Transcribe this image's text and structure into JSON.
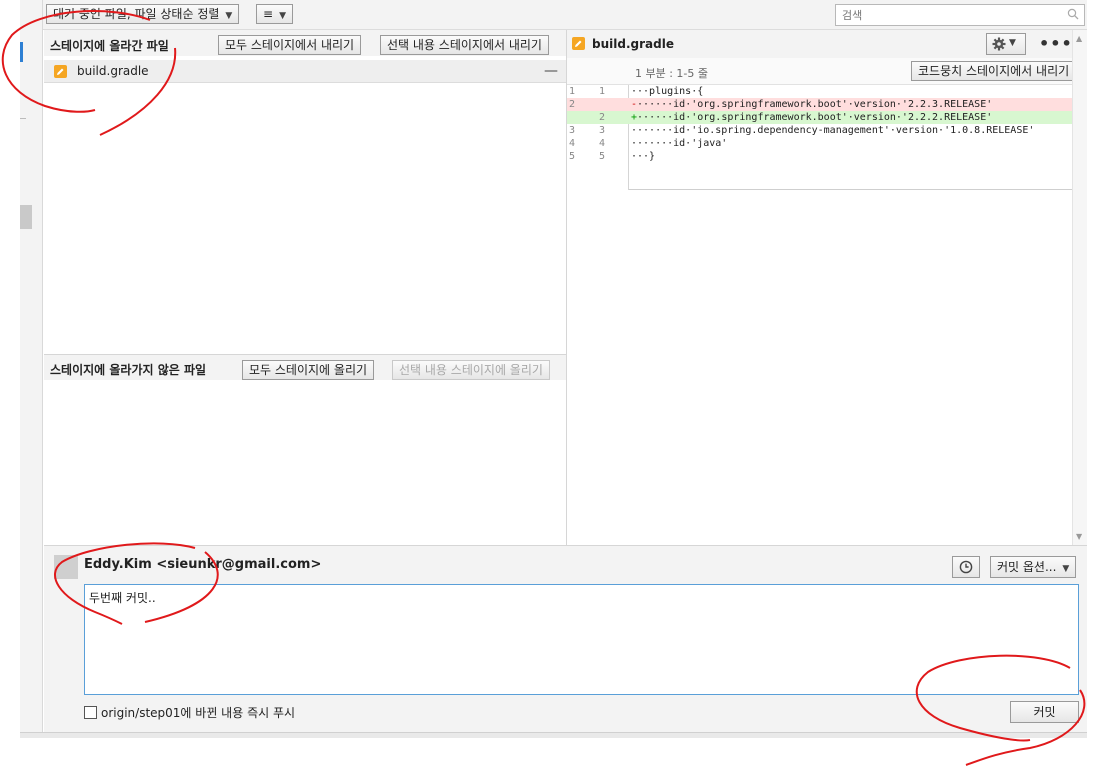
{
  "toolbar": {
    "filter_label": "대기 중인 파일, 파일 상태순 정렬",
    "view_label": "≡",
    "search_placeholder": "검색"
  },
  "staged": {
    "title": "스테이지에 올라간 파일",
    "unstage_all": "모두 스테이지에서 내리기",
    "unstage_selected": "선택 내용 스테이지에서 내리기",
    "files": [
      {
        "name": "build.gradle",
        "status": "modified"
      }
    ]
  },
  "unstaged": {
    "title": "스테이지에 올라가지 않은 파일",
    "stage_all": "모두 스테이지에 올리기",
    "stage_selected": "선택 내용 스테이지에 올리기"
  },
  "diff": {
    "file_name": "build.gradle",
    "hunk_label": "1 부분 : 1-5 줄",
    "unstage_hunk": "코드뭉치 스테이지에서 내리기",
    "lines": [
      {
        "old": "1",
        "new": "1",
        "type": "ctx",
        "sign": "",
        "text": "···plugins·{"
      },
      {
        "old": "2",
        "new": "",
        "type": "del",
        "sign": "-",
        "text": "······id·'org.springframework.boot'·version·'2.2.3.RELEASE'"
      },
      {
        "old": "",
        "new": "2",
        "type": "add",
        "sign": "+",
        "text": "······id·'org.springframework.boot'·version·'2.2.2.RELEASE'"
      },
      {
        "old": "3",
        "new": "3",
        "type": "ctx",
        "sign": "",
        "text": "·······id·'io.spring.dependency-management'·version·'1.0.8.RELEASE'"
      },
      {
        "old": "4",
        "new": "4",
        "type": "ctx",
        "sign": "",
        "text": "·······id·'java'"
      },
      {
        "old": "5",
        "new": "5",
        "type": "ctx",
        "sign": "",
        "text": "···}"
      }
    ]
  },
  "commit": {
    "author": "Eddy.Kim <sieunkr@gmail.com>",
    "options_label": "커밋 옵션...",
    "message": "두번째 커밋..",
    "push_label": "origin/step01에 바뀐 내용 즉시 푸시",
    "commit_button": "커밋"
  },
  "colors": {
    "accent": "#2d7fd3",
    "deleted_bg": "#ffdede",
    "added_bg": "#d8f7d0",
    "modified_icon": "#f5a623",
    "annotation": "#e0191b"
  },
  "icons": [
    "chevron-down-icon",
    "search-icon",
    "pencil-icon",
    "collapse-icon",
    "gear-icon",
    "more-icon",
    "clock-icon",
    "checkbox-icon"
  ]
}
